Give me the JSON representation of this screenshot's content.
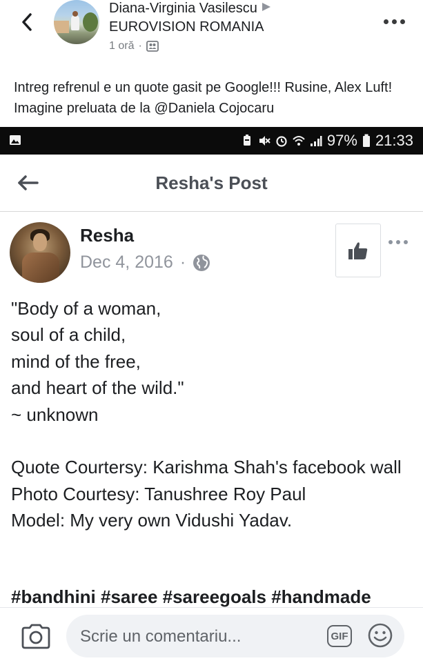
{
  "outer_post": {
    "author": "Diana-Virginia Vasilescu",
    "group": "EUROVISION ROMANIA",
    "time": "1 oră",
    "caption": "Intreg refrenul e un quote gasit pe Google!!! Rusine, Alex Luft! Imagine preluata de la @Daniela Cojocaru"
  },
  "status_bar": {
    "battery": "97%",
    "time": "21:33"
  },
  "inner_header": {
    "title": "Resha's Post"
  },
  "inner_post": {
    "author": "Resha",
    "date": "Dec 4, 2016",
    "separator": "·",
    "text": "\"Body of a woman,\nsoul of a child,\nmind of the free,\nand heart of the wild.\"\n~ unknown\n\nQuote Courtersy: Karishma Shah's facebook wall\nPhoto Courtesy: Tanushree Roy Paul\nModel: My very own Vidushi Yadav.",
    "hashtags": "#bandhini #saree #sareegoals #handmade"
  },
  "comment_bar": {
    "placeholder": "Scrie un comentariu...",
    "gif_label": "GIF"
  },
  "icons": {
    "back": "chevron-left-icon",
    "audience": "friends-icon",
    "inner_back": "arrow-left-icon",
    "privacy": "globe-icon",
    "like": "thumbs-up-icon",
    "camera": "camera-icon",
    "emoji": "smiley-icon"
  }
}
